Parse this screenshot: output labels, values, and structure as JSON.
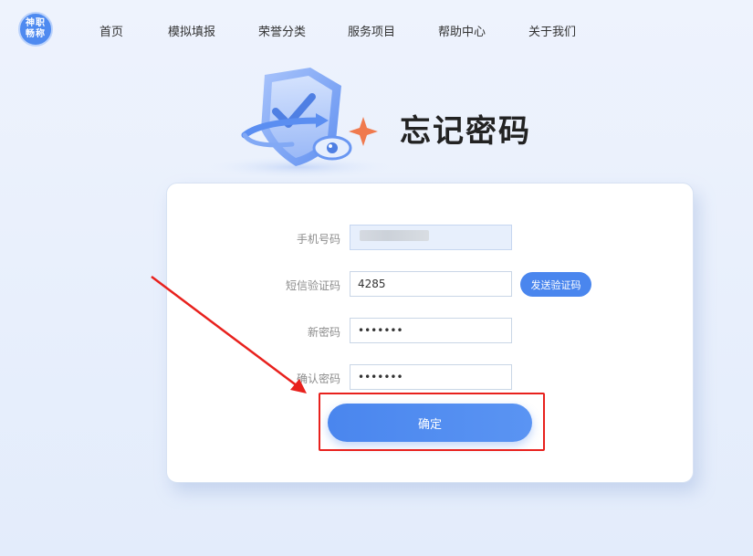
{
  "logo": {
    "text": "神职畅称"
  },
  "nav": {
    "items": [
      {
        "label": "首页"
      },
      {
        "label": "模拟填报"
      },
      {
        "label": "荣誉分类"
      },
      {
        "label": "服务项目"
      },
      {
        "label": "帮助中心"
      },
      {
        "label": "关于我们"
      }
    ]
  },
  "hero": {
    "title": "忘记密码"
  },
  "form": {
    "phone": {
      "label": "手机号码",
      "value": ""
    },
    "sms": {
      "label": "短信验证码",
      "value": "4285",
      "send_label": "发送验证码"
    },
    "new_password": {
      "label": "新密码",
      "value": "•••••••"
    },
    "confirm_password": {
      "label": "确认密码",
      "value": "•••••••"
    },
    "submit_label": "确定"
  },
  "colors": {
    "accent": "#4a86ee",
    "annotation_red": "#e8211d",
    "background": "#e6eefb"
  }
}
